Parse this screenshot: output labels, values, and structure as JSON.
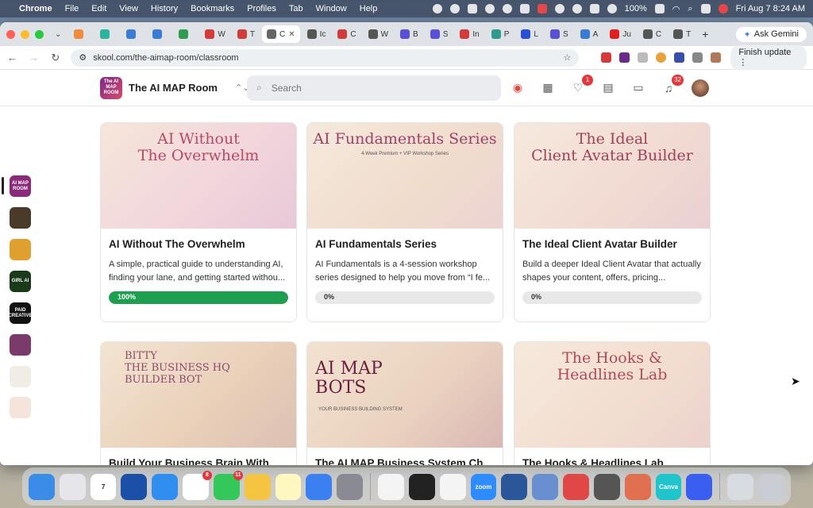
{
  "menubar": {
    "app": "Chrome",
    "items": [
      "File",
      "Edit",
      "View",
      "History",
      "Bookmarks",
      "Profiles",
      "Tab",
      "Window",
      "Help"
    ],
    "battery": "100%",
    "datetime": "Fri Aug 7  8:24 AM"
  },
  "browser": {
    "tabs": [
      {
        "label": "",
        "color": "#f08a3c"
      },
      {
        "label": "",
        "color": "#2bb3a0"
      },
      {
        "label": "",
        "color": "#3a7bd5"
      },
      {
        "label": "",
        "color": "#3a7bd5"
      },
      {
        "label": "",
        "color": "#2e9b4e"
      },
      {
        "label": "W",
        "color": "#d33a3a"
      },
      {
        "label": "T",
        "color": "#d33a3a"
      },
      {
        "label": "C",
        "color": "#666",
        "active": true
      },
      {
        "label": "Ic",
        "color": "#555"
      },
      {
        "label": "C",
        "color": "#d33a3a"
      },
      {
        "label": "W",
        "color": "#555"
      },
      {
        "label": "B",
        "color": "#5b4fd6"
      },
      {
        "label": "S",
        "color": "#5b4fd6"
      },
      {
        "label": "In",
        "color": "#d33a3a"
      },
      {
        "label": "P",
        "color": "#2e9b8e"
      },
      {
        "label": "L",
        "color": "#2a4fd6"
      },
      {
        "label": "S",
        "color": "#5b4fd6"
      },
      {
        "label": "A",
        "color": "#3a7bd5"
      },
      {
        "label": "Ju",
        "color": "#e02020"
      },
      {
        "label": "C",
        "color": "#555"
      },
      {
        "label": "T",
        "color": "#555"
      }
    ],
    "close_tab": "✕",
    "new_tab": "+",
    "ask_gemini": "Ask Gemini",
    "url": "skool.com/the-aimap-room/classroom",
    "finish_update": "Finish update"
  },
  "header": {
    "community_name": "The AI MAP Room",
    "logo_text": "The AI MAP ROOM",
    "search_placeholder": "Search",
    "notifications_count": "1",
    "bell_count": "32"
  },
  "rail": [
    {
      "name": "rail-aimap-room",
      "text": "AI MAP ROOM",
      "color": "#8a2a7a",
      "active": true
    },
    {
      "name": "rail-community-2",
      "text": "",
      "color": "#4a3a2a"
    },
    {
      "name": "rail-community-3",
      "text": "",
      "color": "#e0a030"
    },
    {
      "name": "rail-girl-ai",
      "text": "GIRL AI",
      "color": "#1a3a1a"
    },
    {
      "name": "rail-paid-creative",
      "text": "PAID CREATIVE",
      "color": "#111"
    },
    {
      "name": "rail-community-6",
      "text": "",
      "color": "#7a3a6a"
    },
    {
      "name": "rail-community-7",
      "text": "",
      "color": "#f2ede4"
    },
    {
      "name": "rail-community-8",
      "text": "",
      "color": "#f4e4dc"
    }
  ],
  "courses": [
    {
      "title": "AI Without The Overwhelm",
      "description": "A simple, practical guide to understanding AI, finding your lane, and getting started withou...",
      "progress_label": "100%",
      "progress": 100,
      "image_title": "AI Without\nThe Overwhelm",
      "image_sub": ""
    },
    {
      "title": "AI Fundamentals Series",
      "description": "AI Fundamentals is a 4-session workshop series designed to help you move from “I fe...",
      "progress_label": "0%",
      "progress": 0,
      "image_title": "AI Fundamentals Series",
      "image_sub": "4-Week Premium + VIP Workshop Series"
    },
    {
      "title": "The Ideal Client Avatar Builder",
      "description": "Build a deeper Ideal Client Avatar that actually shapes your content, offers, pricing...",
      "progress_label": "0%",
      "progress": 0,
      "image_title": "The Ideal\nClient Avatar Builder",
      "image_sub": ""
    },
    {
      "title": "Build Your Business Brain With Bit...",
      "description": "",
      "progress_label": "",
      "progress": 0,
      "image_title": "BITTY\nTHE BUSINESS HQ\nBUILDER BOT",
      "image_sub": ""
    },
    {
      "title": "The AI MAP Business System Ch...",
      "description": "",
      "progress_label": "",
      "progress": 0,
      "image_title": "AI MAP\nBOTS",
      "image_sub": "YOUR BUSINESS BUILDING SYSTEM"
    },
    {
      "title": "The Hooks & Headlines Lab",
      "description": "",
      "progress_label": "",
      "progress": 0,
      "image_title": "The Hooks &\nHeadlines Lab",
      "image_sub": ""
    }
  ],
  "dock": [
    {
      "name": "finder",
      "color": "#3b8be8",
      "badge": ""
    },
    {
      "name": "launchpad",
      "color": "#e6e6ea",
      "badge": ""
    },
    {
      "name": "calendar",
      "color": "#ffffff",
      "text": "7",
      "badge": ""
    },
    {
      "name": "navigator",
      "color": "#1b4fa8",
      "badge": ""
    },
    {
      "name": "safari",
      "color": "#2f8ef0",
      "badge": ""
    },
    {
      "name": "reminders",
      "color": "#ffffff",
      "badge": "8"
    },
    {
      "name": "messages",
      "color": "#34c759",
      "badge": "11"
    },
    {
      "name": "photos",
      "color": "#f5c542",
      "badge": ""
    },
    {
      "name": "notes",
      "color": "#fff7c0",
      "badge": ""
    },
    {
      "name": "mail-app",
      "color": "#3a80f0",
      "badge": ""
    },
    {
      "name": "system-settings",
      "color": "#8a8a92",
      "badge": ""
    },
    {
      "name": "freeform",
      "color": "#f4f4f4",
      "badge": ""
    },
    {
      "name": "terminal",
      "color": "#222",
      "badge": ""
    },
    {
      "name": "chrome",
      "color": "#f4f4f4",
      "badge": ""
    },
    {
      "name": "zoom",
      "color": "#2d8cff",
      "text": "zoom",
      "badge": ""
    },
    {
      "name": "word",
      "color": "#2b579a",
      "badge": ""
    },
    {
      "name": "app-blue",
      "color": "#6a8fd0",
      "badge": ""
    },
    {
      "name": "app-red",
      "color": "#e04848",
      "badge": ""
    },
    {
      "name": "calculator",
      "color": "#555",
      "badge": ""
    },
    {
      "name": "claude",
      "color": "#e07050",
      "badge": ""
    },
    {
      "name": "canva",
      "color": "#20c4cb",
      "text": "Canva",
      "badge": ""
    },
    {
      "name": "app-loom",
      "color": "#3a5ef0",
      "badge": ""
    },
    {
      "name": "downloads-stack",
      "color": "#d8dbe0",
      "badge": ""
    },
    {
      "name": "trash",
      "color": "#c9ccd2",
      "badge": ""
    }
  ]
}
